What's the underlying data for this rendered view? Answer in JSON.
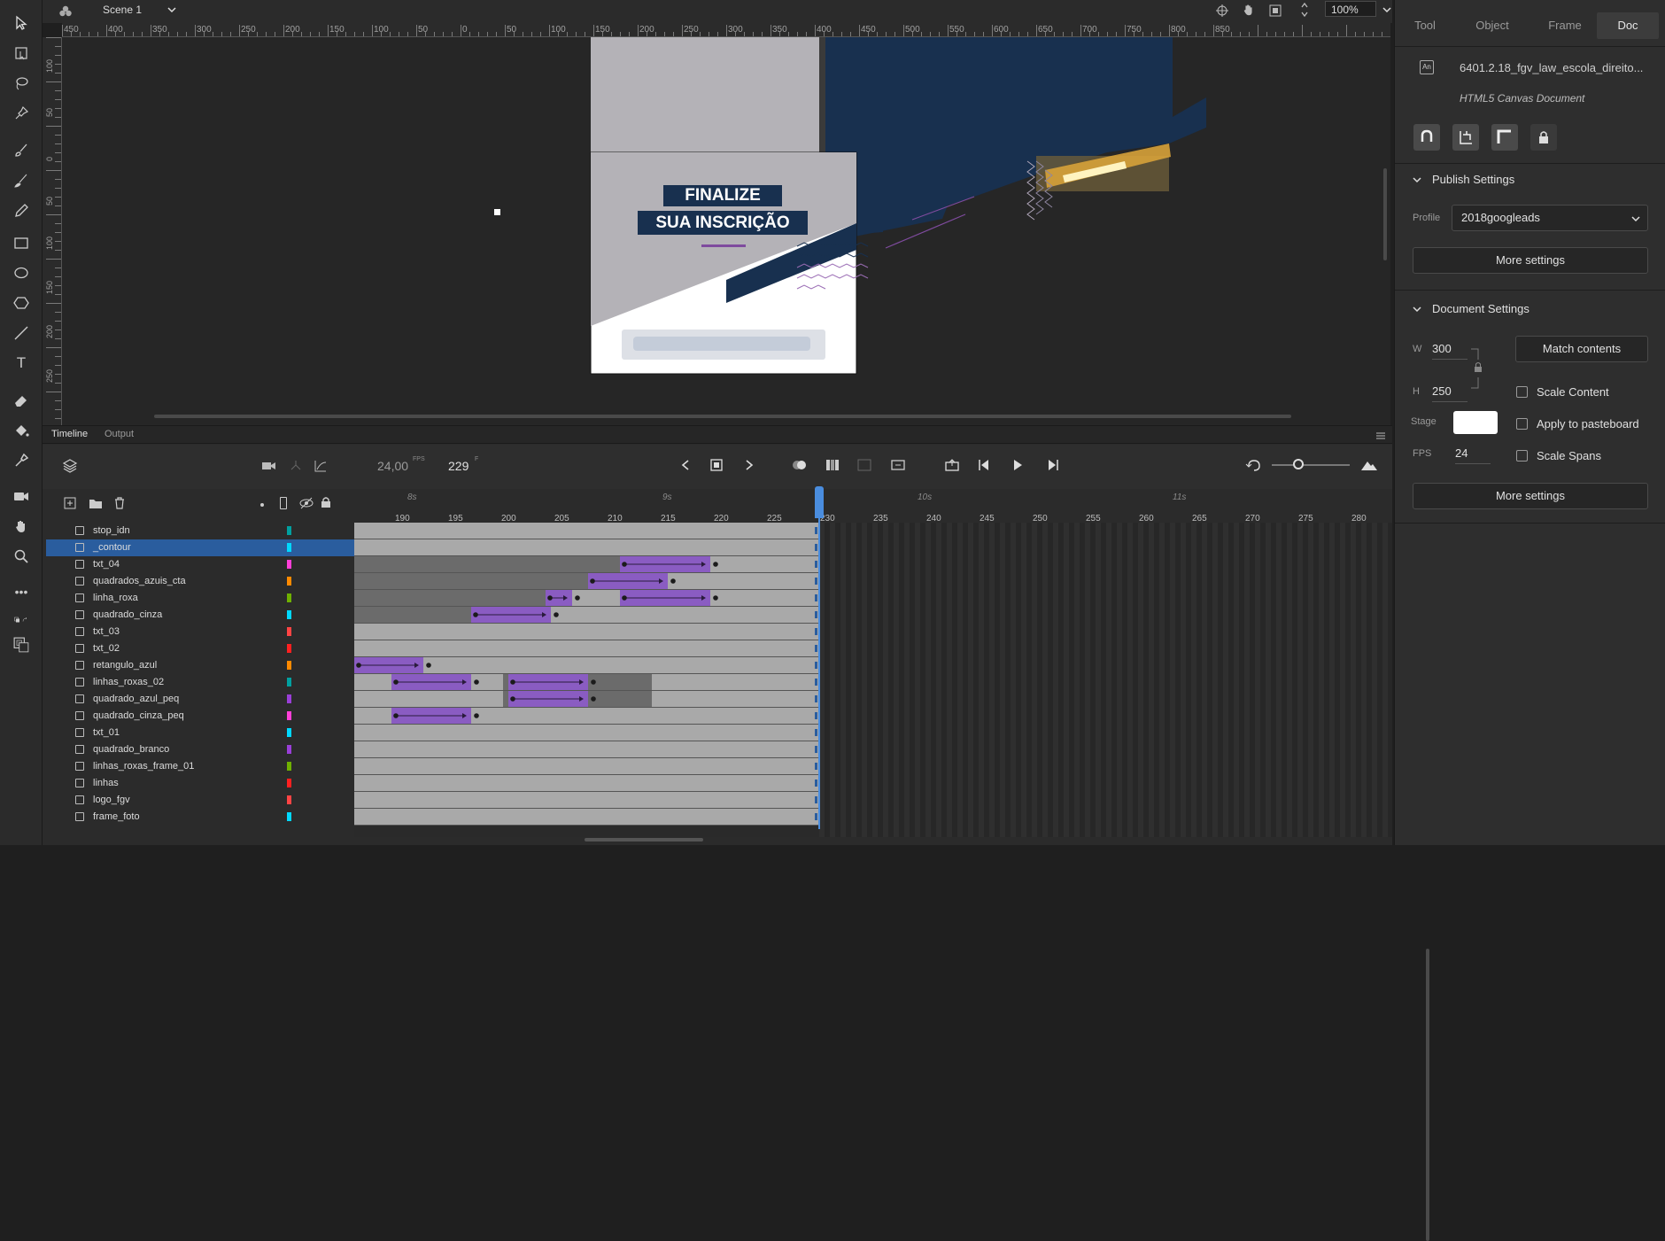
{
  "toolbar": {
    "tools": [
      "selection-tool",
      "subselection-tool",
      "lasso-tool",
      "pin-tool",
      "paint-brush-tool",
      "brush-tool",
      "pencil-tool",
      "rectangle-tool",
      "oval-tool",
      "polystar-tool",
      "line-tool",
      "text-tool",
      "eraser-tool",
      "paint-bucket-tool",
      "eyedropper-tool",
      "camera-tool",
      "hand-tool",
      "zoom-tool",
      "more-tools"
    ]
  },
  "topbar": {
    "scene": "Scene 1",
    "zoom": "100%"
  },
  "ruler": {
    "top_labels": [
      "450",
      "400",
      "350",
      "300",
      "250",
      "200",
      "150",
      "100",
      "50",
      "0",
      "50",
      "100",
      "150",
      "200",
      "250",
      "300",
      "350",
      "400",
      "450",
      "500",
      "550",
      "600",
      "650",
      "700",
      "750",
      "800",
      "850"
    ],
    "left_labels": [
      "100",
      "50",
      "0",
      "50",
      "100",
      "150",
      "200",
      "250"
    ]
  },
  "stage": {
    "headline1": "FINALIZE",
    "headline2": "SUA INSCRIÇÃO",
    "colors": {
      "navy": "#18304f",
      "gray": "#b4b2b7",
      "purple": "#7f4b9e",
      "white": "#ffffff"
    }
  },
  "right_panel": {
    "tabs": [
      "Tool",
      "Object",
      "Frame",
      "Doc"
    ],
    "active_tab": "Doc",
    "doc_name": "6401.2.18_fgv_law_escola_direito...",
    "doc_type": "HTML5 Canvas Document",
    "doc_icon_label": "An",
    "publish_settings": {
      "title": "Publish Settings",
      "profile_label": "Profile",
      "profile_value": "2018googleads",
      "more_settings": "More settings"
    },
    "document_settings": {
      "title": "Document Settings",
      "w_label": "W",
      "w_value": "300",
      "h_label": "H",
      "h_value": "250",
      "match_contents": "Match contents",
      "stage_label": "Stage",
      "stage_color": "#ffffff",
      "fps_label": "FPS",
      "fps_value": "24",
      "scale_content": "Scale Content",
      "apply_to_pasteboard": "Apply to pasteboard",
      "scale_spans": "Scale Spans",
      "more_settings": "More settings"
    }
  },
  "timeline": {
    "tabs": [
      "Timeline",
      "Output"
    ],
    "fps": "24,00",
    "fps_unit": "FPS",
    "frame": "229",
    "frame_unit": "F",
    "seconds": [
      "8s",
      "9s",
      "10s",
      "11s"
    ],
    "frame_numbers": [
      "190",
      "195",
      "200",
      "205",
      "210",
      "215",
      "220",
      "225",
      "230",
      "235",
      "240",
      "245",
      "250",
      "255",
      "260",
      "265",
      "270",
      "275",
      "280"
    ],
    "layers": [
      {
        "name": "stop_idn",
        "color": "#00a0a0"
      },
      {
        "name": "_contour",
        "color": "#00d8ff",
        "selected": true
      },
      {
        "name": "txt_04",
        "color": "#ff3fd8"
      },
      {
        "name": "quadrados_azuis_cta",
        "color": "#ff8a00"
      },
      {
        "name": "linha_roxa",
        "color": "#6fb000"
      },
      {
        "name": "quadrado_cinza",
        "color": "#00d8ff"
      },
      {
        "name": "txt_03",
        "color": "#ff4444"
      },
      {
        "name": "txt_02",
        "color": "#ff2020"
      },
      {
        "name": "retangulo_azul",
        "color": "#ff8a00"
      },
      {
        "name": "linhas_roxas_02",
        "color": "#00a0a0"
      },
      {
        "name": "quadrado_azul_peq",
        "color": "#9a3fd8"
      },
      {
        "name": "quadrado_cinza_peq",
        "color": "#ff3fd8"
      },
      {
        "name": "txt_01",
        "color": "#00d8ff"
      },
      {
        "name": "quadrado_branco",
        "color": "#9a3fd8"
      },
      {
        "name": "linhas_roxas_frame_01",
        "color": "#6fb000"
      },
      {
        "name": "linhas",
        "color": "#ff2020"
      },
      {
        "name": "logo_fgv",
        "color": "#ff4444"
      },
      {
        "name": "frame_foto",
        "color": "#00d8ff"
      }
    ]
  }
}
